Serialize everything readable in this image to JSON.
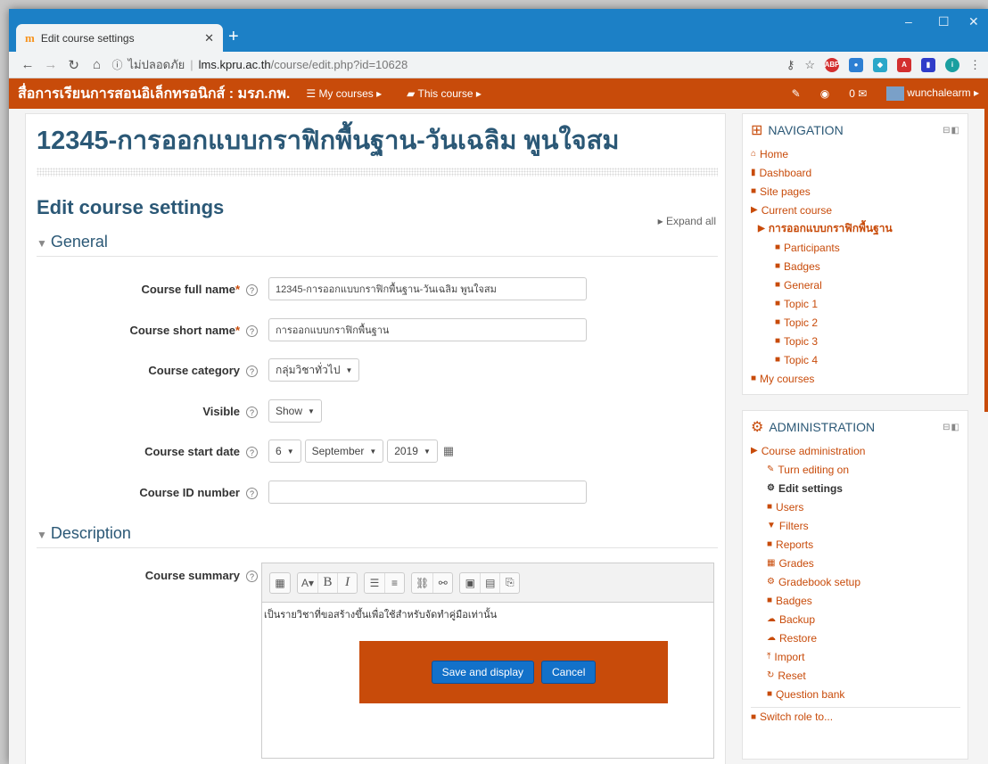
{
  "browser": {
    "tab_title": "Edit course settings",
    "favicon": "m",
    "url_prefix": "ไม่ปลอดภัย",
    "url_host": "lms.kpru.ac.th",
    "url_path": "/course/edit.php?id=10628",
    "extensions": [
      "ABP",
      "●",
      "◆",
      "A",
      "▮"
    ],
    "profile_letter": "i"
  },
  "topbar": {
    "site_name": "สื่อการเรียนการสอนอิเล็กทรอนิกส์ : มรภ.กพ.",
    "my_courses": "My courses ▸",
    "this_course": "This course ▸",
    "messages": "0 ✉",
    "user": "wunchalearm ▸"
  },
  "main": {
    "course_title": "12345-การออกแบบกราฟิกพื้นฐาน-วันเฉลิม พูนใจสม",
    "page_title": "Edit course settings",
    "expand_all": "Expand all",
    "section_general": "General",
    "section_description": "Description",
    "fields": {
      "full_name_label": "Course full name",
      "full_name_value": "12345-การออกแบบกราฟิกพื้นฐาน-วันเฉลิม พูนใจสม",
      "short_name_label": "Course short name",
      "short_name_value": "การออกแบบกราฟิกพื้นฐาน",
      "category_label": "Course category",
      "category_value": "กลุ่มวิชาทั่วไป",
      "visible_label": "Visible",
      "visible_value": "Show",
      "start_date_label": "Course start date",
      "start_day": "6",
      "start_month": "September",
      "start_year": "2019",
      "id_number_label": "Course ID number",
      "id_number_value": "",
      "summary_label": "Course summary",
      "summary_text": "เป็นรายวิชาที่ขอสร้างขึ้นเพื่อใช้สำหรับจัดทำคู่มือเท่านั้น"
    },
    "save_label": "Save and display",
    "cancel_label": "Cancel"
  },
  "navigation": {
    "title": "NAVIGATION",
    "items": [
      {
        "label": "Home",
        "icon": "home-icon"
      },
      {
        "label": "Dashboard",
        "icon": "dashboard-icon"
      },
      {
        "label": "Site pages",
        "icon": "folder-icon"
      },
      {
        "label": "Current course",
        "icon": "folder-open-icon"
      },
      {
        "label": "การออกแบบกราฟิกพื้นฐาน",
        "icon": "folder-open-icon"
      },
      {
        "label": "Participants",
        "icon": "folder-icon"
      },
      {
        "label": "Badges",
        "icon": "folder-icon"
      },
      {
        "label": "General",
        "icon": "folder-icon"
      },
      {
        "label": "Topic 1",
        "icon": "folder-icon"
      },
      {
        "label": "Topic 2",
        "icon": "folder-icon"
      },
      {
        "label": "Topic 3",
        "icon": "folder-icon"
      },
      {
        "label": "Topic 4",
        "icon": "folder-icon"
      },
      {
        "label": "My courses",
        "icon": "folder-icon"
      }
    ]
  },
  "administration": {
    "title": "ADMINISTRATION",
    "items": [
      {
        "label": "Course administration",
        "icon": "folder-open-icon"
      },
      {
        "label": "Turn editing on",
        "icon": "pencil-icon"
      },
      {
        "label": "Edit settings",
        "icon": "cog-icon"
      },
      {
        "label": "Users",
        "icon": "folder-icon"
      },
      {
        "label": "Filters",
        "icon": "filter-icon"
      },
      {
        "label": "Reports",
        "icon": "folder-icon"
      },
      {
        "label": "Grades",
        "icon": "table-icon"
      },
      {
        "label": "Gradebook setup",
        "icon": "cog-icon"
      },
      {
        "label": "Badges",
        "icon": "folder-icon"
      },
      {
        "label": "Backup",
        "icon": "upload-icon"
      },
      {
        "label": "Restore",
        "icon": "upload-icon"
      },
      {
        "label": "Import",
        "icon": "import-icon"
      },
      {
        "label": "Reset",
        "icon": "reset-icon"
      },
      {
        "label": "Question bank",
        "icon": "folder-icon"
      },
      {
        "label": "Switch role to...",
        "icon": "folder-icon"
      }
    ]
  },
  "colors": {
    "accent": "#c84b0a",
    "title": "#2b5876",
    "chrome": "#1c80c6",
    "button": "#1371c9"
  }
}
